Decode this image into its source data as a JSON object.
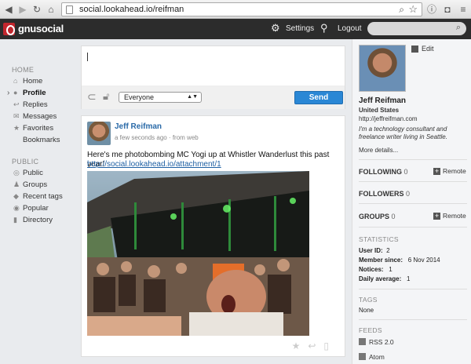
{
  "browser": {
    "url": "social.lookahead.io/reifman"
  },
  "app": {
    "logo_text": "gnusocial",
    "settings_label": "Settings",
    "logout_label": "Logout",
    "search_placeholder": ""
  },
  "leftnav": {
    "home_section": "HOME",
    "home_items": [
      {
        "label": "Home",
        "icon": "home-icon"
      },
      {
        "label": "Profile",
        "icon": "person-icon",
        "active": true
      },
      {
        "label": "Replies",
        "icon": "reply-icon"
      },
      {
        "label": "Messages",
        "icon": "envelope-icon"
      },
      {
        "label": "Favorites",
        "icon": "star-icon"
      },
      {
        "label": "Bookmarks",
        "icon": ""
      }
    ],
    "public_section": "PUBLIC",
    "public_items": [
      {
        "label": "Public",
        "icon": "globe-icon"
      },
      {
        "label": "Groups",
        "icon": "group-icon"
      },
      {
        "label": "Recent tags",
        "icon": "tag-icon"
      },
      {
        "label": "Popular",
        "icon": "popular-icon"
      },
      {
        "label": "Directory",
        "icon": "directory-icon"
      }
    ]
  },
  "composer": {
    "scope": "Everyone",
    "send_label": "Send"
  },
  "notice": {
    "author": "Jeff Reifman",
    "meta": "a few seconds ago · from web",
    "text": "Here's me photobombing MC Yogi up at Whistler Wanderlust this past year!",
    "link": "http://social.lookahead.io/attachment/1"
  },
  "profile": {
    "edit_label": "Edit",
    "name": "Jeff Reifman",
    "location": "United States",
    "url": "http://jeffreifman.com",
    "bio": "I'm a technology consultant and freelance writer living in Seattle.",
    "more_label": "More details...",
    "following_label": "FOLLOWING",
    "following_count": "0",
    "followers_label": "FOLLOWERS",
    "followers_count": "0",
    "groups_label": "GROUPS",
    "groups_count": "0",
    "remote_label": "Remote",
    "statistics_label": "STATISTICS",
    "stats": [
      {
        "label": "User ID:",
        "value": "2"
      },
      {
        "label": "Member since:",
        "value": "6 Nov 2014"
      },
      {
        "label": "Notices:",
        "value": "1"
      },
      {
        "label": "Daily average:",
        "value": "1"
      }
    ],
    "tags_label": "TAGS",
    "tags_value": "None",
    "feeds_label": "FEEDS",
    "feeds": [
      "RSS 2.0",
      "Atom"
    ]
  },
  "colors": {
    "accent_blue": "#2a87d5",
    "header_bg": "#2c2c2c",
    "logo_red": "#c2262d",
    "link_blue": "#1d5fa3"
  }
}
